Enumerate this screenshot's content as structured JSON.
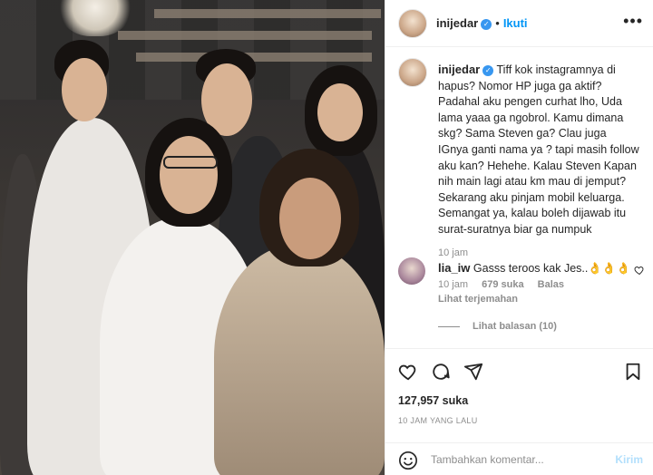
{
  "post": {
    "username": "inijedar",
    "follow_label": "Ikuti",
    "more_glyph": "•••",
    "verified_glyph": "✓"
  },
  "caption": {
    "username": "inijedar",
    "text": "Tiff kok instagramnya di hapus? Nomor HP juga ga aktif? Padahal aku pengen curhat lho, Uda lama yaaa ga ngobrol. Kamu dimana skg? Sama Steven ga? Clau juga IGnya ganti nama ya ? tapi masih follow aku kan? Hehehe. Kalau Steven Kapan nih main lagi atau km mau di jemput? Sekarang aku pinjam mobil keluarga. Semangat ya, kalau boleh dijawab itu surat-suratnya biar ga numpuk",
    "age": "10 jam"
  },
  "comment": {
    "username": "lia_iw",
    "text": "Gasss teroos kak Jes..👌👌👌",
    "age": "10 jam",
    "likes": "679 suka",
    "reply_label": "Balas",
    "translate_label": "Lihat terjemahan",
    "view_replies_label": "Lihat balasan (10)"
  },
  "actions": {
    "icons": [
      "heart-icon",
      "comment-icon",
      "share-icon",
      "bookmark-icon"
    ],
    "likes_count": "127,957 suka",
    "timestamp": "10 JAM YANG LALU"
  },
  "composer": {
    "placeholder": "Tambahkan komentar...",
    "post_label": "Kirim",
    "emoji_icon": "smiley-icon"
  },
  "colors": {
    "accent": "#0095f6",
    "verified": "#3897f0",
    "muted": "#8e8e8e",
    "post_disabled": "#b2dffc"
  }
}
